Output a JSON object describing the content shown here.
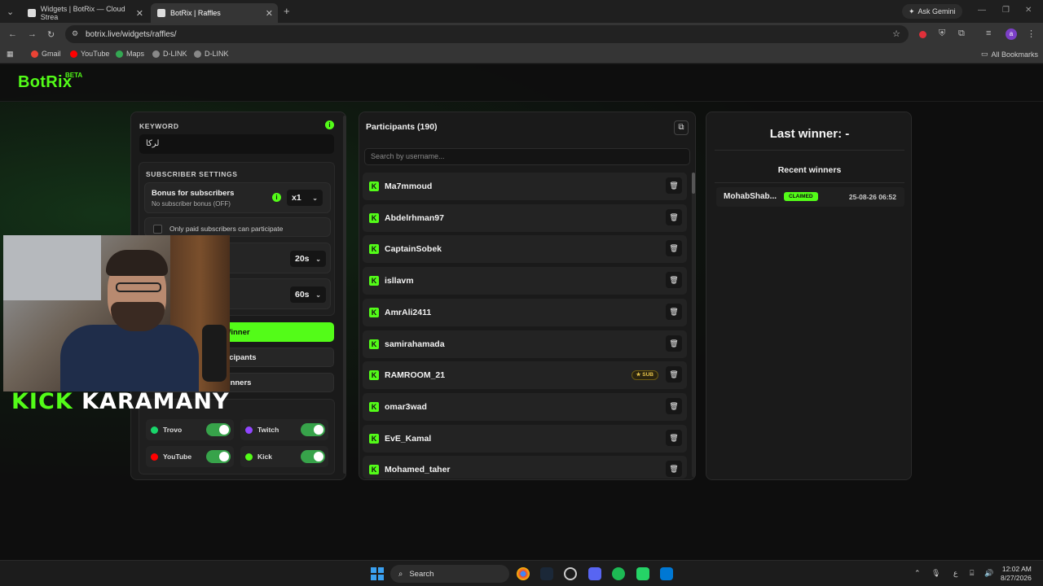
{
  "browser": {
    "tabs": [
      {
        "title": "Widgets | BotRix — Cloud Strea",
        "active": false
      },
      {
        "title": "BotRix | Raffles",
        "active": true
      }
    ],
    "new_tab": "+",
    "ask_gemini": "Ask Gemini",
    "url": "botrix.live/widgets/raffles/",
    "bookmarks": [
      "Gmail",
      "YouTube",
      "Maps",
      "D-LINK",
      "D-LINK"
    ],
    "all_bookmarks": "All Bookmarks",
    "profile_initial": "a"
  },
  "app": {
    "logo": "BotRix",
    "beta": "BETA"
  },
  "settings": {
    "keyword_label": "KEYWORD",
    "keyword_info": "i",
    "keyword_value": "لركا",
    "subscriber_settings_label": "SUBSCRIBER SETTINGS",
    "bonus_title": "Bonus for subscribers",
    "bonus_subtitle": "No subscriber bonus (OFF)",
    "bonus_multiplier": "x1",
    "paid_only_label": "Only paid subscribers can participate",
    "timer1_value": "20s",
    "timer2_value": "60s",
    "pick_winner_label": "Winner",
    "participants_btn_label": "articipants",
    "winners_btn_label": "winners",
    "platforms": [
      {
        "name": "Trovo",
        "enabled": true,
        "color": "#19d66b"
      },
      {
        "name": "Twitch",
        "enabled": true,
        "color": "#9146ff"
      },
      {
        "name": "YouTube",
        "enabled": true,
        "color": "#ff0000"
      },
      {
        "name": "Kick",
        "enabled": true,
        "color": "#53fc18"
      }
    ]
  },
  "participants": {
    "title": "Participants (190)",
    "search_placeholder": "Search by username...",
    "items": [
      {
        "name": "Ma7mmoud"
      },
      {
        "name": "Abdelrhman97"
      },
      {
        "name": "CaptainSobek"
      },
      {
        "name": "isllavm"
      },
      {
        "name": "AmrAli2411"
      },
      {
        "name": "samirahamada"
      },
      {
        "name": "RAMROOM_21",
        "badge": "SUB"
      },
      {
        "name": "omar3wad"
      },
      {
        "name": "EvE_Kamal"
      },
      {
        "name": "Mohamed_taher"
      }
    ]
  },
  "winners": {
    "last_winner": "Last winner: -",
    "recent_title": "Recent winners",
    "recent": [
      {
        "name": "MohabShab...",
        "status": "CLAIMED",
        "date": "25-08-26 06:52"
      }
    ]
  },
  "overlay": {
    "kick_word": "KICK",
    "streamer_name": "KARAMANY"
  },
  "taskbar": {
    "search_label": "Search",
    "time": "12:02 AM",
    "date": "8/27/2026",
    "lang": "ع"
  },
  "colors": {
    "accent": "#53fc18",
    "claimed": "#53fc18",
    "sub_badge": "#e6c34a"
  }
}
